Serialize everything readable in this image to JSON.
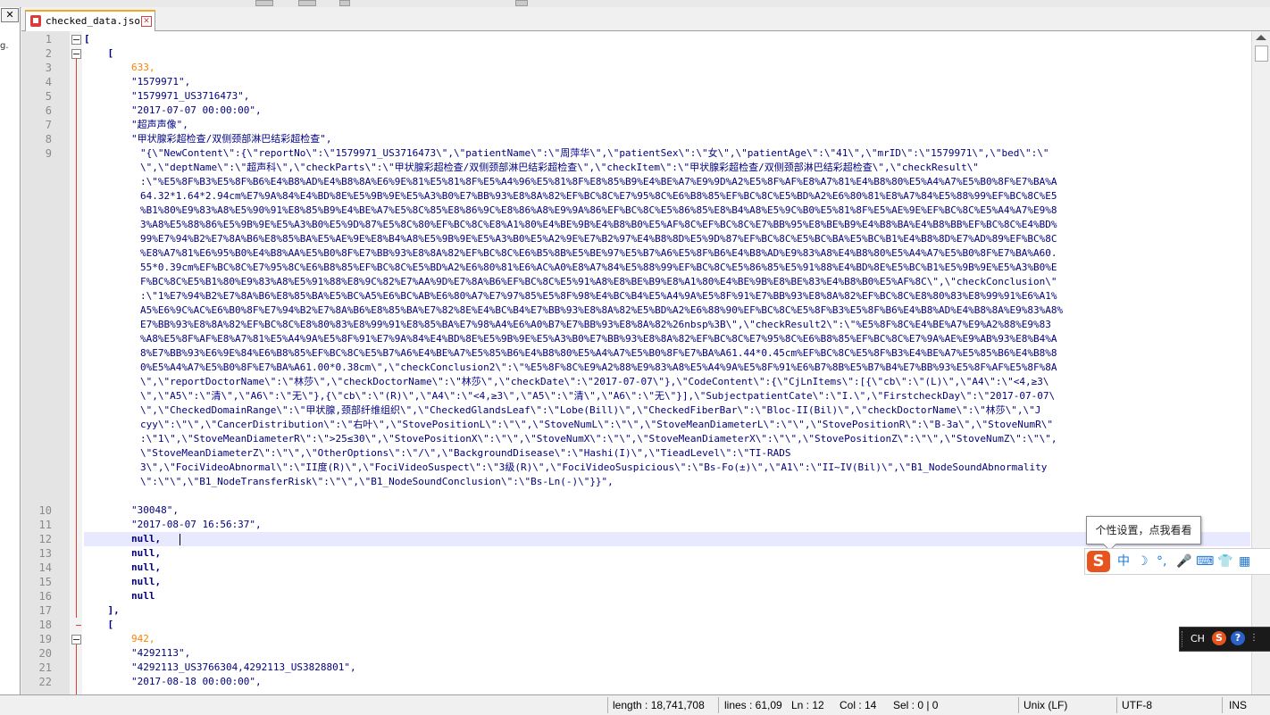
{
  "tab": {
    "filename": "checked_data.json",
    "close": "✕"
  },
  "left_panel": {
    "close": "✕",
    "fragment": "g."
  },
  "editor": {
    "lines": [
      {
        "n": "1",
        "text": "["
      },
      {
        "n": "2",
        "text": "    ["
      },
      {
        "n": "3",
        "text": "        633,"
      },
      {
        "n": "4",
        "text": "        \"1579971\","
      },
      {
        "n": "5",
        "text": "        \"1579971_US3716473\","
      },
      {
        "n": "6",
        "text": "        \"2017-07-07 00:00:00\","
      },
      {
        "n": "7",
        "text": "        \"超声声像\","
      },
      {
        "n": "8",
        "text": "        \"甲状腺彩超检查/双侧颈部淋巴结彩超检查\","
      },
      {
        "n": "9",
        "text": ""
      },
      {
        "n": "10",
        "text": "        \"30048\","
      },
      {
        "n": "11",
        "text": "        \"2017-08-07 16:56:37\","
      },
      {
        "n": "12",
        "text": "        null,"
      },
      {
        "n": "13",
        "text": "        null,"
      },
      {
        "n": "14",
        "text": "        null,"
      },
      {
        "n": "15",
        "text": "        null,"
      },
      {
        "n": "16",
        "text": "        null"
      },
      {
        "n": "17",
        "text": "    ],"
      },
      {
        "n": "18",
        "text": "    ["
      },
      {
        "n": "19",
        "text": "        942,"
      },
      {
        "n": "20",
        "text": "        \"4292113\","
      },
      {
        "n": "21",
        "text": "        \"4292113_US3766304,4292113_US3828801\","
      },
      {
        "n": "22",
        "text": "        \"2017-08-18 00:00:00\","
      }
    ],
    "line9_wrapped": [
      "\"{\\\"NewContent\\\":{\\\"reportNo\\\":\\\"1579971_US3716473\\\",\\\"patientName\\\":\\\"周萍华\\\",\\\"patientSex\\\":\\\"女\\\",\\\"patientAge\\\":\\\"41\\\",\\\"mrID\\\":\\\"1579971\\\",\\\"bed\\\":\\\"",
      "\\\",\\\"deptName\\\":\\\"超声科\\\",\\\"checkParts\\\":\\\"甲状腺彩超检查/双侧颈部淋巴结彩超检查\\\",\\\"checkItem\\\":\\\"甲状腺彩超检查/双侧颈部淋巴结彩超检查\\\",\\\"checkResult\\\"",
      ":\\\"%E5%8F%B3%E5%8F%B6%E4%B8%AD%E4%B8%8A%E6%9E%81%E5%81%8F%E5%A4%96%E5%81%8F%E8%85%B9%E4%BE%A7%E9%9D%A2%E5%8F%AF%E8%A7%81%E4%B8%80%E5%A4%A7%E5%B0%8F%E7%BA%A",
      "64.32*1.64*2.94cm%E7%9A%84%E4%BD%8E%E5%9B%9E%E5%A3%B0%E7%BB%93%E8%8A%82%EF%BC%8C%E7%95%8C%E6%B8%85%EF%BC%8C%E5%BD%A2%E6%80%81%E8%A7%84%E5%88%99%EF%BC%8C%E5",
      "%B1%80%E9%83%A8%E5%90%91%E8%85%B9%E4%BE%A7%E5%8C%85%E8%86%9C%E8%86%A8%E9%9A%86%EF%BC%8C%E5%86%85%E8%B4%A8%E5%9C%B0%E5%81%8F%E5%AE%9E%EF%BC%8C%E5%A4%A7%E9%8",
      "3%A8%E5%88%86%E5%9B%9E%E5%A3%B0%E5%9D%87%E5%8C%80%EF%BC%8C%E8%A1%80%E4%BE%9B%E4%B8%B0%E5%AF%8C%EF%BC%8C%E7%BB%95%E8%BE%B9%E4%B8%BA%E4%B8%BB%EF%BC%8C%E4%BD%",
      "99%E7%94%B2%E7%8A%B6%E8%85%BA%E5%AE%9E%E8%B4%A8%E5%9B%9E%E5%A3%B0%E5%A2%9E%E7%B2%97%E4%B8%8D%E5%9D%87%EF%BC%8C%E5%BC%BA%E5%BC%B1%E4%B8%8D%E7%AD%89%EF%BC%8C",
      "%E8%A7%81%E6%95%B0%E4%B8%AA%E5%B0%8F%E7%BB%93%E8%8A%82%EF%BC%8C%E6%B5%8B%E5%BE%97%E5%B7%A6%E5%8F%B6%E4%B8%AD%E9%83%A8%E4%B8%80%E5%A4%A7%E5%B0%8F%E7%BA%A60.",
      "55*0.39cm%EF%BC%8C%E7%95%8C%E6%B8%85%EF%BC%8C%E5%BD%A2%E6%80%81%E6%AC%A0%E8%A7%84%E5%88%99%EF%BC%8C%E5%86%85%E5%91%88%E4%BD%8E%E5%BC%B1%E5%9B%9E%E5%A3%B0%E",
      "F%BC%8C%E5%B1%80%E9%83%A8%E5%91%88%E8%9C%82%E7%AA%9D%E7%8A%B6%EF%BC%8C%E5%91%A8%E8%BE%B9%E8%A1%80%E4%BE%9B%E8%BE%83%E4%B8%B0%E5%AF%8C\\\",\\\"checkConclusion\\\"",
      ":\\\"1%E7%94%B2%E7%8A%B6%E8%85%BA%E5%BC%A5%E6%BC%AB%E6%80%A7%E7%97%85%E5%8F%98%E4%BC%B4%E5%A4%9A%E5%8F%91%E7%BB%93%E8%8A%82%EF%BC%8C%E8%80%83%E8%99%91%E6%A1%",
      "A5%E6%9C%AC%E6%B0%8F%E7%94%B2%E7%8A%B6%E8%85%BA%E7%82%8E%E4%BC%B4%E7%BB%93%E8%8A%82%E5%BD%A2%E6%88%90%EF%BC%8C%E5%8F%B3%E5%8F%B6%E4%B8%AD%E4%B8%8A%E9%83%A8%",
      "E7%BB%93%E8%8A%82%EF%BC%8C%E8%80%83%E8%99%91%E8%85%BA%E7%98%A4%E6%A0%B7%E7%BB%93%E8%8A%82%26nbsp%3B\\\",\\\"checkResult2\\\":\\\"%E5%8F%8C%E4%BE%A7%E9%A2%88%E9%83",
      "%A8%E5%8F%AF%E8%A7%81%E5%A4%9A%E5%8F%91%E7%9A%84%E4%BD%8E%E5%9B%9E%E5%A3%B0%E7%BB%93%E8%8A%82%EF%BC%8C%E7%95%8C%E6%B8%85%EF%BC%8C%E7%9A%AE%E9%AB%93%E8%B4%A",
      "8%E7%BB%93%E6%9E%84%E6%B8%85%EF%BC%8C%E5%B7%A6%E4%BE%A7%E5%85%B6%E4%B8%80%E5%A4%A7%E5%B0%8F%E7%BA%A61.44*0.45cm%EF%BC%8C%E5%8F%B3%E4%BE%A7%E5%85%B6%E4%B8%8",
      "0%E5%A4%A7%E5%B0%8F%E7%BA%A61.00*0.38cm\\\",\\\"checkConclusion2\\\":\\\"%E5%8F%8C%E9%A2%88%E9%83%A8%E5%A4%9A%E5%8F%91%E6%B7%8B%E5%B7%B4%E7%BB%93%E5%8F%AF%E5%8F%8A",
      "\\\",\\\"reportDoctorName\\\":\\\"林莎\\\",\\\"checkDoctorName\\\":\\\"林莎\\\",\\\"checkDate\\\":\\\"2017-07-07\\\"},\\\"CodeContent\\\":{\\\"CjLnItems\\\":[{\\\"cb\\\":\\\"(L)\\\",\\\"A4\\\":\\\"<4,≥3\\",
      "\\\",\\\"A5\\\":\\\"清\\\",\\\"A6\\\":\\\"无\\\"},{\\\"cb\\\":\\\"(R)\\\",\\\"A4\\\":\\\"<4,≥3\\\",\\\"A5\\\":\\\"清\\\",\\\"A6\\\":\\\"无\\\"}],\\\"SubjectpatientCate\\\":\\\"I.\\\",\\\"FirstcheckDay\\\":\\\"2017-07-07\\",
      "\\\",\\\"CheckedDomainRange\\\":\\\"甲状腺,颈部纤维组织\\\",\\\"CheckedGlandsLeaf\\\":\\\"Lobe(Bill)\\\",\\\"CheckedFiberBar\\\":\\\"Bloc-II(Bil)\\\",\\\"checkDoctorName\\\":\\\"林莎\\\",\\\"J",
      "cyy\\\":\\\"\\\",\\\"CancerDistribution\\\":\\\"右叶\\\",\\\"StovePositionL\\\":\\\"\\\",\\\"StoveNumL\\\":\\\"\\\",\\\"StoveMeanDiameterL\\\":\\\"\\\",\\\"StovePositionR\\\":\\\"B-3a\\\",\\\"StoveNumR\\\"",
      ":\\\"1\\\",\\\"StoveMeanDiameterR\\\":\\\">25≤30\\\",\\\"StovePositionX\\\":\\\"\\\",\\\"StoveNumX\\\":\\\"\\\",\\\"StoveMeanDiameterX\\\":\\\"\\\",\\\"StovePositionZ\\\":\\\"\\\",\\\"StoveNumZ\\\":\\\"\\\",",
      "\\\"StoveMeanDiameterZ\\\":\\\"\\\",\\\"OtherOptions\\\":\\\"/\\\",\\\"BackgroundDisease\\\":\\\"Hashi(I)\\\",\\\"TieadLevel\\\":\\\"TI-RADS",
      "3\\\",\\\"FociVideoAbnormal\\\":\\\"II度(R)\\\",\\\"FociVideoSuspect\\\":\\\"3级(R)\\\",\\\"FociVideoSuspicious\\\":\\\"Bs-Fo(±)\\\",\\\"A1\\\":\\\"II~IV(Bil)\\\",\\\"B1_NodeSoundAbnormality",
      "\\\":\\\"\\\",\\\"B1_NodeTransferRisk\\\":\\\"\\\",\\\"B1_NodeSoundConclusion\\\":\\\"Bs-Ln(-)\\\"}}\","
    ]
  },
  "status": {
    "length": "length : 18,741,708",
    "lines": "lines : 61,09",
    "ln": "Ln : 12",
    "col": "Col : 14",
    "sel": "Sel : 0 | 0",
    "eol": "Unix (LF)",
    "encoding": "UTF-8",
    "mode": "INS"
  },
  "tooltip": {
    "text": "个性设置，点我看看"
  },
  "ime": {
    "logo": "S",
    "lang": "中",
    "moon": "☽",
    "dot": "°,",
    "mic": "🎤",
    "kbd": "⌨",
    "shirt": "👕",
    "grid": "▦"
  },
  "langbar": {
    "ch": "CH",
    "s": "S",
    "q": "?",
    "dots": "⋮"
  }
}
